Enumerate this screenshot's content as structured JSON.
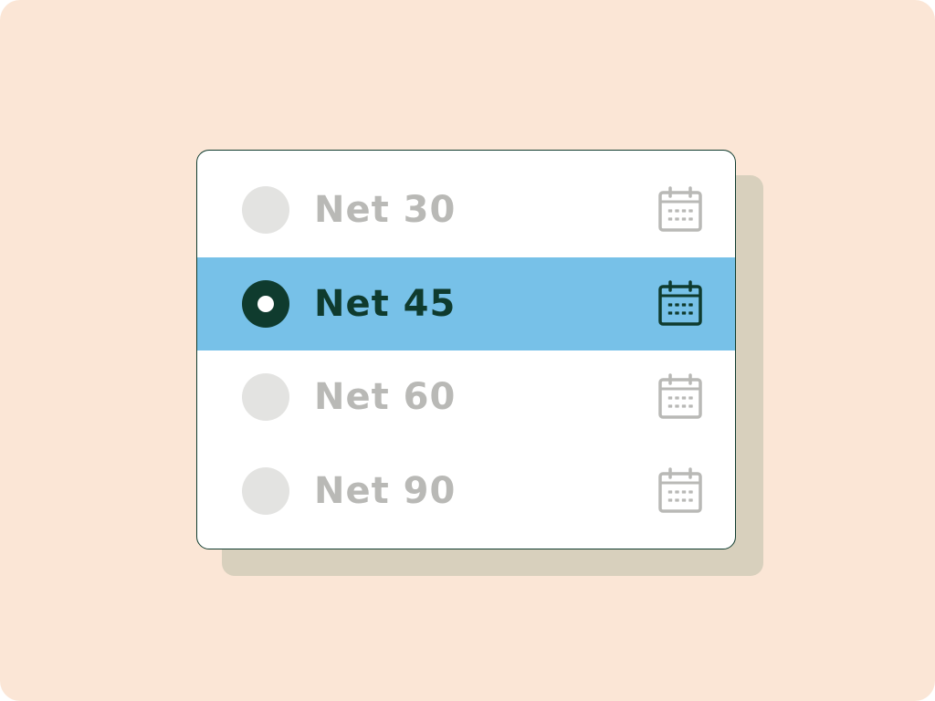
{
  "colors": {
    "background": "#fbe6d6",
    "shadow": "#d8d0bd",
    "card": "#ffffff",
    "border": "#0f3b2e",
    "selected_row": "#77c1e8",
    "selected_ink": "#0f3b2e",
    "muted_radio": "#e3e3e1",
    "muted_text": "#b9b9b6",
    "muted_icon": "#b9b9b6"
  },
  "payment_terms": {
    "options": [
      {
        "label": "Net 30",
        "selected": false,
        "icon": "calendar-icon"
      },
      {
        "label": "Net 45",
        "selected": true,
        "icon": "calendar-icon"
      },
      {
        "label": "Net 60",
        "selected": false,
        "icon": "calendar-icon"
      },
      {
        "label": "Net 90",
        "selected": false,
        "icon": "calendar-icon"
      }
    ]
  }
}
